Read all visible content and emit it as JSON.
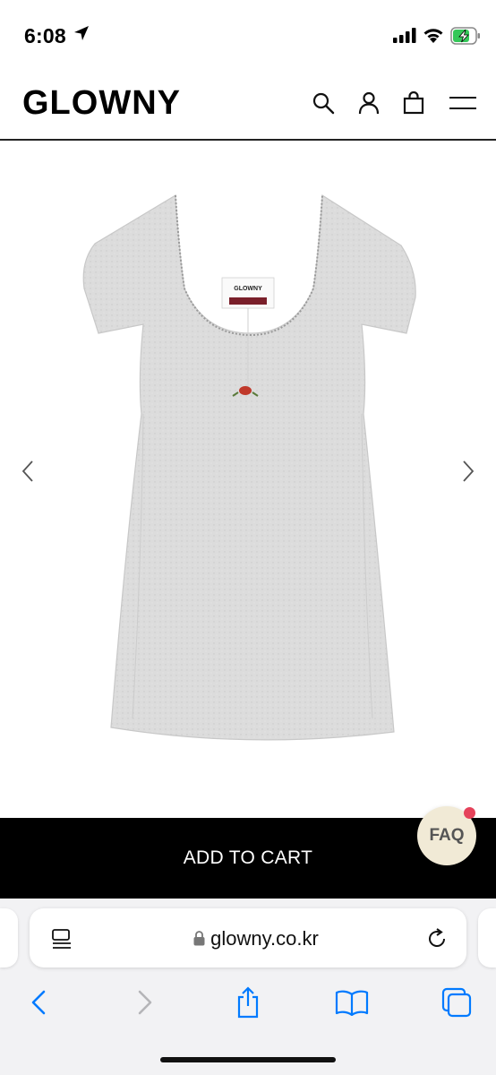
{
  "status_bar": {
    "time": "6:08",
    "location_icon": "location-arrow-icon",
    "signal_icon": "cellular-signal-icon",
    "wifi_icon": "wifi-icon",
    "battery_icon": "battery-charging-icon",
    "battery_color": "#34c759"
  },
  "header": {
    "brand": "GLOWNY",
    "icons": [
      "search-icon",
      "account-icon",
      "shopping-bag-icon",
      "menu-icon"
    ]
  },
  "gallery": {
    "prev_icon": "chevron-left-icon",
    "next_icon": "chevron-right-icon",
    "product_color": "#dcdcdc",
    "label_text": "GLOWNY"
  },
  "cart": {
    "label": "ADD TO CART",
    "background": "#000000"
  },
  "faq": {
    "label": "FAQ",
    "background": "#f1ead6",
    "badge_color": "#e5425a"
  },
  "browser": {
    "url": "glowny.co.kr",
    "toolbar": [
      "back-icon",
      "forward-icon",
      "share-icon",
      "bookmarks-icon",
      "tabs-icon"
    ],
    "accent": "#007aff"
  }
}
